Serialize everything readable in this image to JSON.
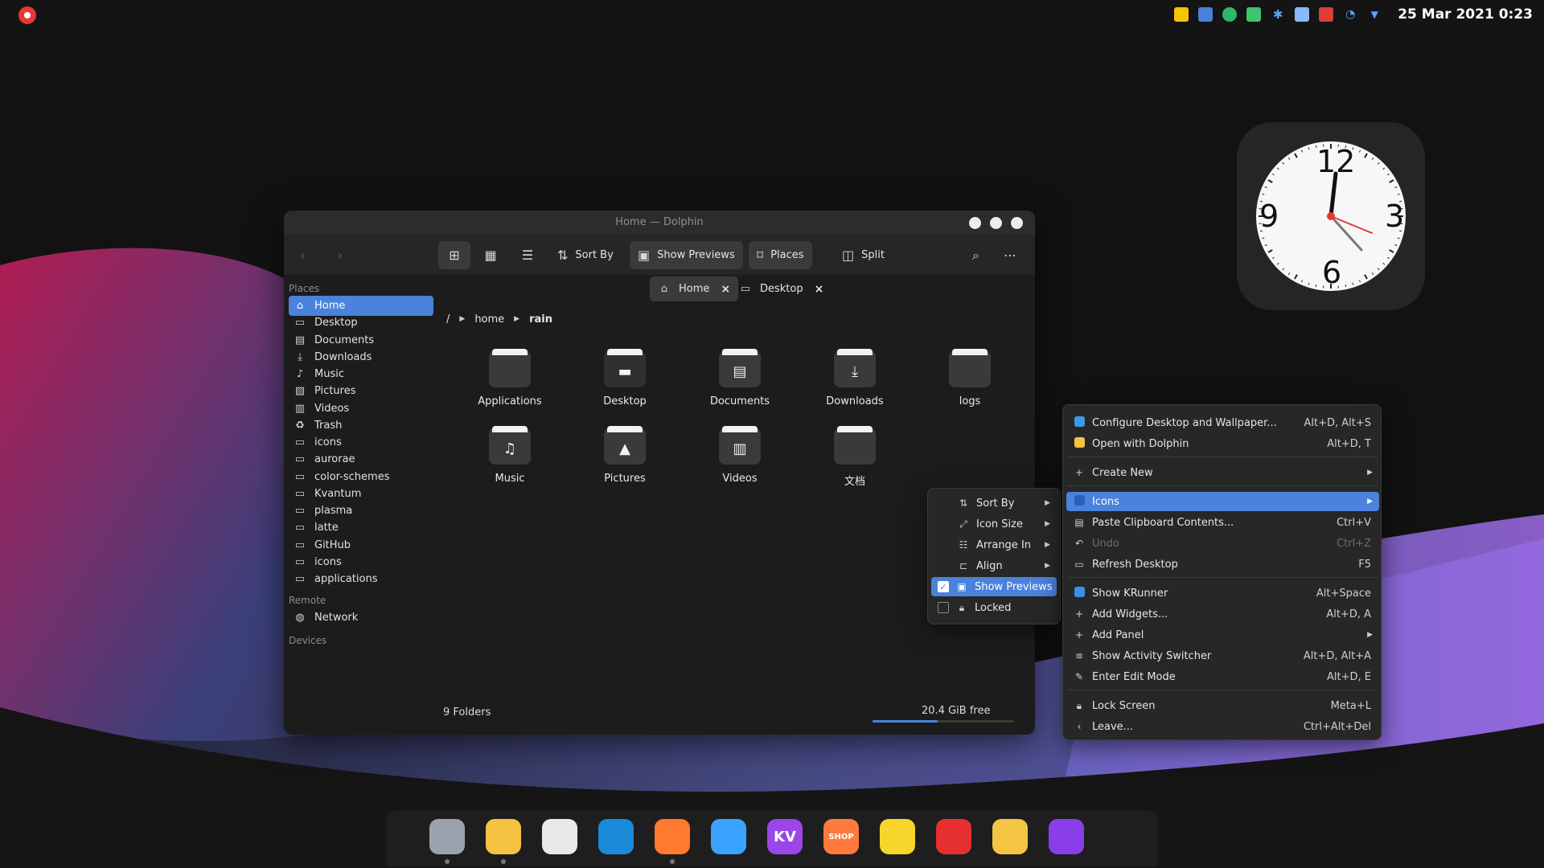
{
  "topbar": {
    "clock": "25 Mar 2021 0:23",
    "tray_icons": [
      "notes-icon",
      "document-icon",
      "kdeconnect-icon",
      "battery-icon",
      "bluetooth-icon",
      "clipboard-icon",
      "calendar-icon",
      "wifi-icon",
      "expand-icon"
    ]
  },
  "clock_widget": {
    "numbers": [
      "12",
      "3",
      "6",
      "9"
    ],
    "time": "0:23"
  },
  "window": {
    "title": "Home — Dolphin",
    "toolbar": {
      "sort_by": "Sort By",
      "show_previews": "Show Previews",
      "places": "Places",
      "split": "Split"
    },
    "tabs": [
      {
        "label": "Home",
        "icon": "home-icon",
        "active": true
      },
      {
        "label": "Desktop",
        "icon": "desktop-icon",
        "active": false
      }
    ],
    "sidebar": {
      "places_heading": "Places",
      "places": [
        {
          "label": "Home",
          "icon": "home-icon",
          "active": true
        },
        {
          "label": "Desktop",
          "icon": "desktop-icon"
        },
        {
          "label": "Documents",
          "icon": "documents-icon"
        },
        {
          "label": "Downloads",
          "icon": "downloads-icon"
        },
        {
          "label": "Music",
          "icon": "music-icon"
        },
        {
          "label": "Pictures",
          "icon": "pictures-icon"
        },
        {
          "label": "Videos",
          "icon": "videos-icon"
        },
        {
          "label": "Trash",
          "icon": "trash-icon"
        },
        {
          "label": "icons",
          "icon": "folder-icon"
        },
        {
          "label": "aurorae",
          "icon": "folder-icon"
        },
        {
          "label": "color-schemes",
          "icon": "folder-icon"
        },
        {
          "label": "Kvantum",
          "icon": "folder-icon"
        },
        {
          "label": "plasma",
          "icon": "folder-icon"
        },
        {
          "label": "latte",
          "icon": "folder-icon"
        },
        {
          "label": "GitHub",
          "icon": "folder-icon"
        },
        {
          "label": "icons",
          "icon": "folder-icon"
        },
        {
          "label": "applications",
          "icon": "folder-icon"
        }
      ],
      "remote_heading": "Remote",
      "remote": [
        {
          "label": "Network",
          "icon": "network-icon"
        }
      ],
      "devices_heading": "Devices"
    },
    "breadcrumb": [
      "/",
      "home",
      "rain"
    ],
    "folders": [
      {
        "label": "Applications",
        "icon": "folder-applications-icon"
      },
      {
        "label": "Desktop",
        "icon": "folder-desktop-icon"
      },
      {
        "label": "Documents",
        "icon": "folder-documents-icon"
      },
      {
        "label": "Downloads",
        "icon": "folder-downloads-icon"
      },
      {
        "label": "logs",
        "icon": "folder-icon"
      },
      {
        "label": "Music",
        "icon": "folder-music-icon"
      },
      {
        "label": "Pictures",
        "icon": "folder-pictures-icon"
      },
      {
        "label": "Videos",
        "icon": "folder-videos-icon"
      },
      {
        "label": "文档",
        "icon": "folder-icon"
      }
    ],
    "status": {
      "count": "9 Folders",
      "free": "20.4 GiB free",
      "free_fraction": 0.46
    }
  },
  "icons_submenu": {
    "items": [
      {
        "label": "Sort By",
        "icon": "sort-icon",
        "submenu": true
      },
      {
        "label": "Icon Size",
        "icon": "icon-size-icon",
        "submenu": true
      },
      {
        "label": "Arrange In",
        "icon": "arrange-icon",
        "submenu": true
      },
      {
        "label": "Align",
        "icon": "align-icon",
        "submenu": true
      },
      {
        "label": "Show Previews",
        "icon": "previews-icon",
        "checked": true,
        "active": true
      },
      {
        "label": "Locked",
        "icon": "lock-icon",
        "checked": false
      }
    ]
  },
  "desktop_menu": {
    "items": [
      {
        "label": "Configure Desktop and Wallpaper...",
        "shortcut": "Alt+D, Alt+S",
        "icon": "configure-icon"
      },
      {
        "label": "Open with Dolphin",
        "shortcut": "Alt+D, T",
        "icon": "dolphin-icon"
      },
      {
        "label": "Create New",
        "shortcut": "",
        "icon": "create-new-icon",
        "submenu": true
      },
      {
        "label": "Icons",
        "shortcut": "",
        "icon": "icons-icon",
        "submenu": true,
        "active": true
      },
      {
        "label": "Paste Clipboard Contents...",
        "shortcut": "Ctrl+V",
        "icon": "paste-icon"
      },
      {
        "label": "Undo",
        "shortcut": "Ctrl+Z",
        "icon": "undo-icon",
        "disabled": true
      },
      {
        "label": "Refresh Desktop",
        "shortcut": "F5",
        "icon": "refresh-icon"
      },
      {
        "label": "Show KRunner",
        "shortcut": "Alt+Space",
        "icon": "krunner-icon"
      },
      {
        "label": "Add Widgets...",
        "shortcut": "Alt+D, A",
        "icon": "plus-icon"
      },
      {
        "label": "Add Panel",
        "shortcut": "",
        "icon": "plus-icon",
        "submenu": true
      },
      {
        "label": "Show Activity Switcher",
        "shortcut": "Alt+D, Alt+A",
        "icon": "activities-icon"
      },
      {
        "label": "Enter Edit Mode",
        "shortcut": "Alt+D, E",
        "icon": "edit-icon"
      },
      {
        "label": "Lock Screen",
        "shortcut": "Meta+L",
        "icon": "lock-icon"
      },
      {
        "label": "Leave...",
        "shortcut": "Ctrl+Alt+Del",
        "icon": "leave-icon"
      }
    ]
  },
  "dock": {
    "apps": [
      {
        "name": "system-settings-icon",
        "label": "",
        "color": "#9aa3ad",
        "running": true
      },
      {
        "name": "files-icon",
        "label": "",
        "color": "#f5c242",
        "running": true
      },
      {
        "name": "inkscape-icon",
        "label": "",
        "color": "#e8e8e8",
        "running": false
      },
      {
        "name": "edge-dev-icon",
        "label": "",
        "color": "#1b8ad8",
        "running": false
      },
      {
        "name": "firefox-icon",
        "label": "",
        "color": "#ff7a2e",
        "running": true
      },
      {
        "name": "github-desktop-icon",
        "label": "",
        "color": "#3aa3ff",
        "running": false
      },
      {
        "name": "kv-icon",
        "label": "KV",
        "color": "#9b46e6",
        "running": false
      },
      {
        "name": "shop-icon",
        "label": "SHOP",
        "color": "#ff7a3d",
        "running": false
      },
      {
        "name": "music-app-icon",
        "label": "",
        "color": "#f7d52a",
        "running": false
      },
      {
        "name": "netease-music-icon",
        "label": "",
        "color": "#e62f2f",
        "running": false
      },
      {
        "name": "photos-icon",
        "label": "",
        "color": "#f4c542",
        "running": false
      },
      {
        "name": "crop-icon",
        "label": "",
        "color": "#8a3ee8",
        "running": false
      }
    ]
  },
  "colors": {
    "accent": "#4a82dc",
    "window_bg": "#1c1c1c",
    "panel_bg": "#141414",
    "record_red": "#e53935"
  }
}
